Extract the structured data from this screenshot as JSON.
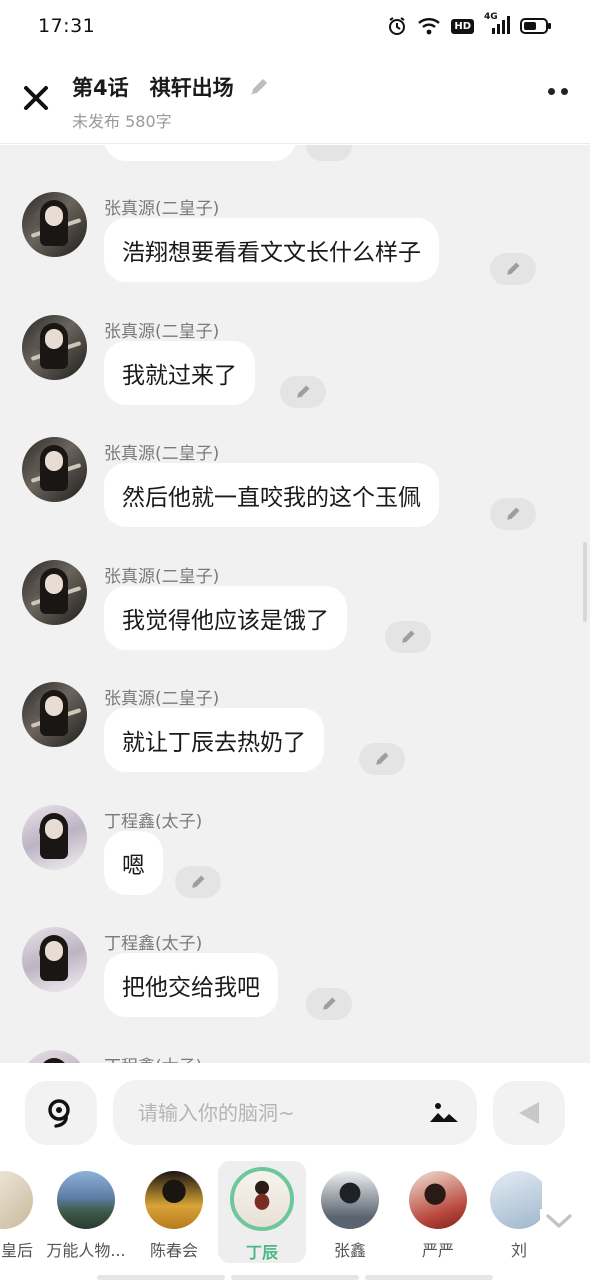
{
  "status_bar": {
    "time": "17:31",
    "icons": [
      "alarm-icon",
      "wifi-icon",
      "hd-icon",
      "signal-4g-icon",
      "battery-icon"
    ],
    "hd_label": "HD",
    "net_label": "4G"
  },
  "header": {
    "title": "第4话　祺轩出场",
    "subtitle": "未发布 580字"
  },
  "messages": [
    {
      "speaker": "张真源(二皇子)",
      "text": "浩翔想要看看文文长什么样子",
      "avatar": "zzy"
    },
    {
      "speaker": "张真源(二皇子)",
      "text": "我就过来了",
      "avatar": "zzy"
    },
    {
      "speaker": "张真源(二皇子)",
      "text": "然后他就一直咬我的这个玉佩",
      "avatar": "zzy"
    },
    {
      "speaker": "张真源(二皇子)",
      "text": "我觉得他应该是饿了",
      "avatar": "zzy"
    },
    {
      "speaker": "张真源(二皇子)",
      "text": "就让丁辰去热奶了",
      "avatar": "zzy"
    },
    {
      "speaker": "丁程鑫(太子)",
      "text": "嗯",
      "avatar": "dcx"
    },
    {
      "speaker": "丁程鑫(太子)",
      "text": "把他交给我吧",
      "avatar": "dcx"
    },
    {
      "speaker": "丁程鑫(太子)",
      "text": "",
      "avatar": "dcx"
    }
  ],
  "input": {
    "placeholder": "请输入你的脑洞~",
    "value": ""
  },
  "characters": [
    {
      "label": "皇后",
      "selected": false
    },
    {
      "label": "万能人物...",
      "selected": false
    },
    {
      "label": "陈春会",
      "selected": false
    },
    {
      "label": "丁辰",
      "selected": true
    },
    {
      "label": "张鑫",
      "selected": false
    },
    {
      "label": "严严",
      "selected": false
    },
    {
      "label": "刘",
      "selected": false
    }
  ],
  "colors": {
    "accent": "#4cb784",
    "chat_bg": "#f1f1f1",
    "bubble": "#ffffff"
  }
}
